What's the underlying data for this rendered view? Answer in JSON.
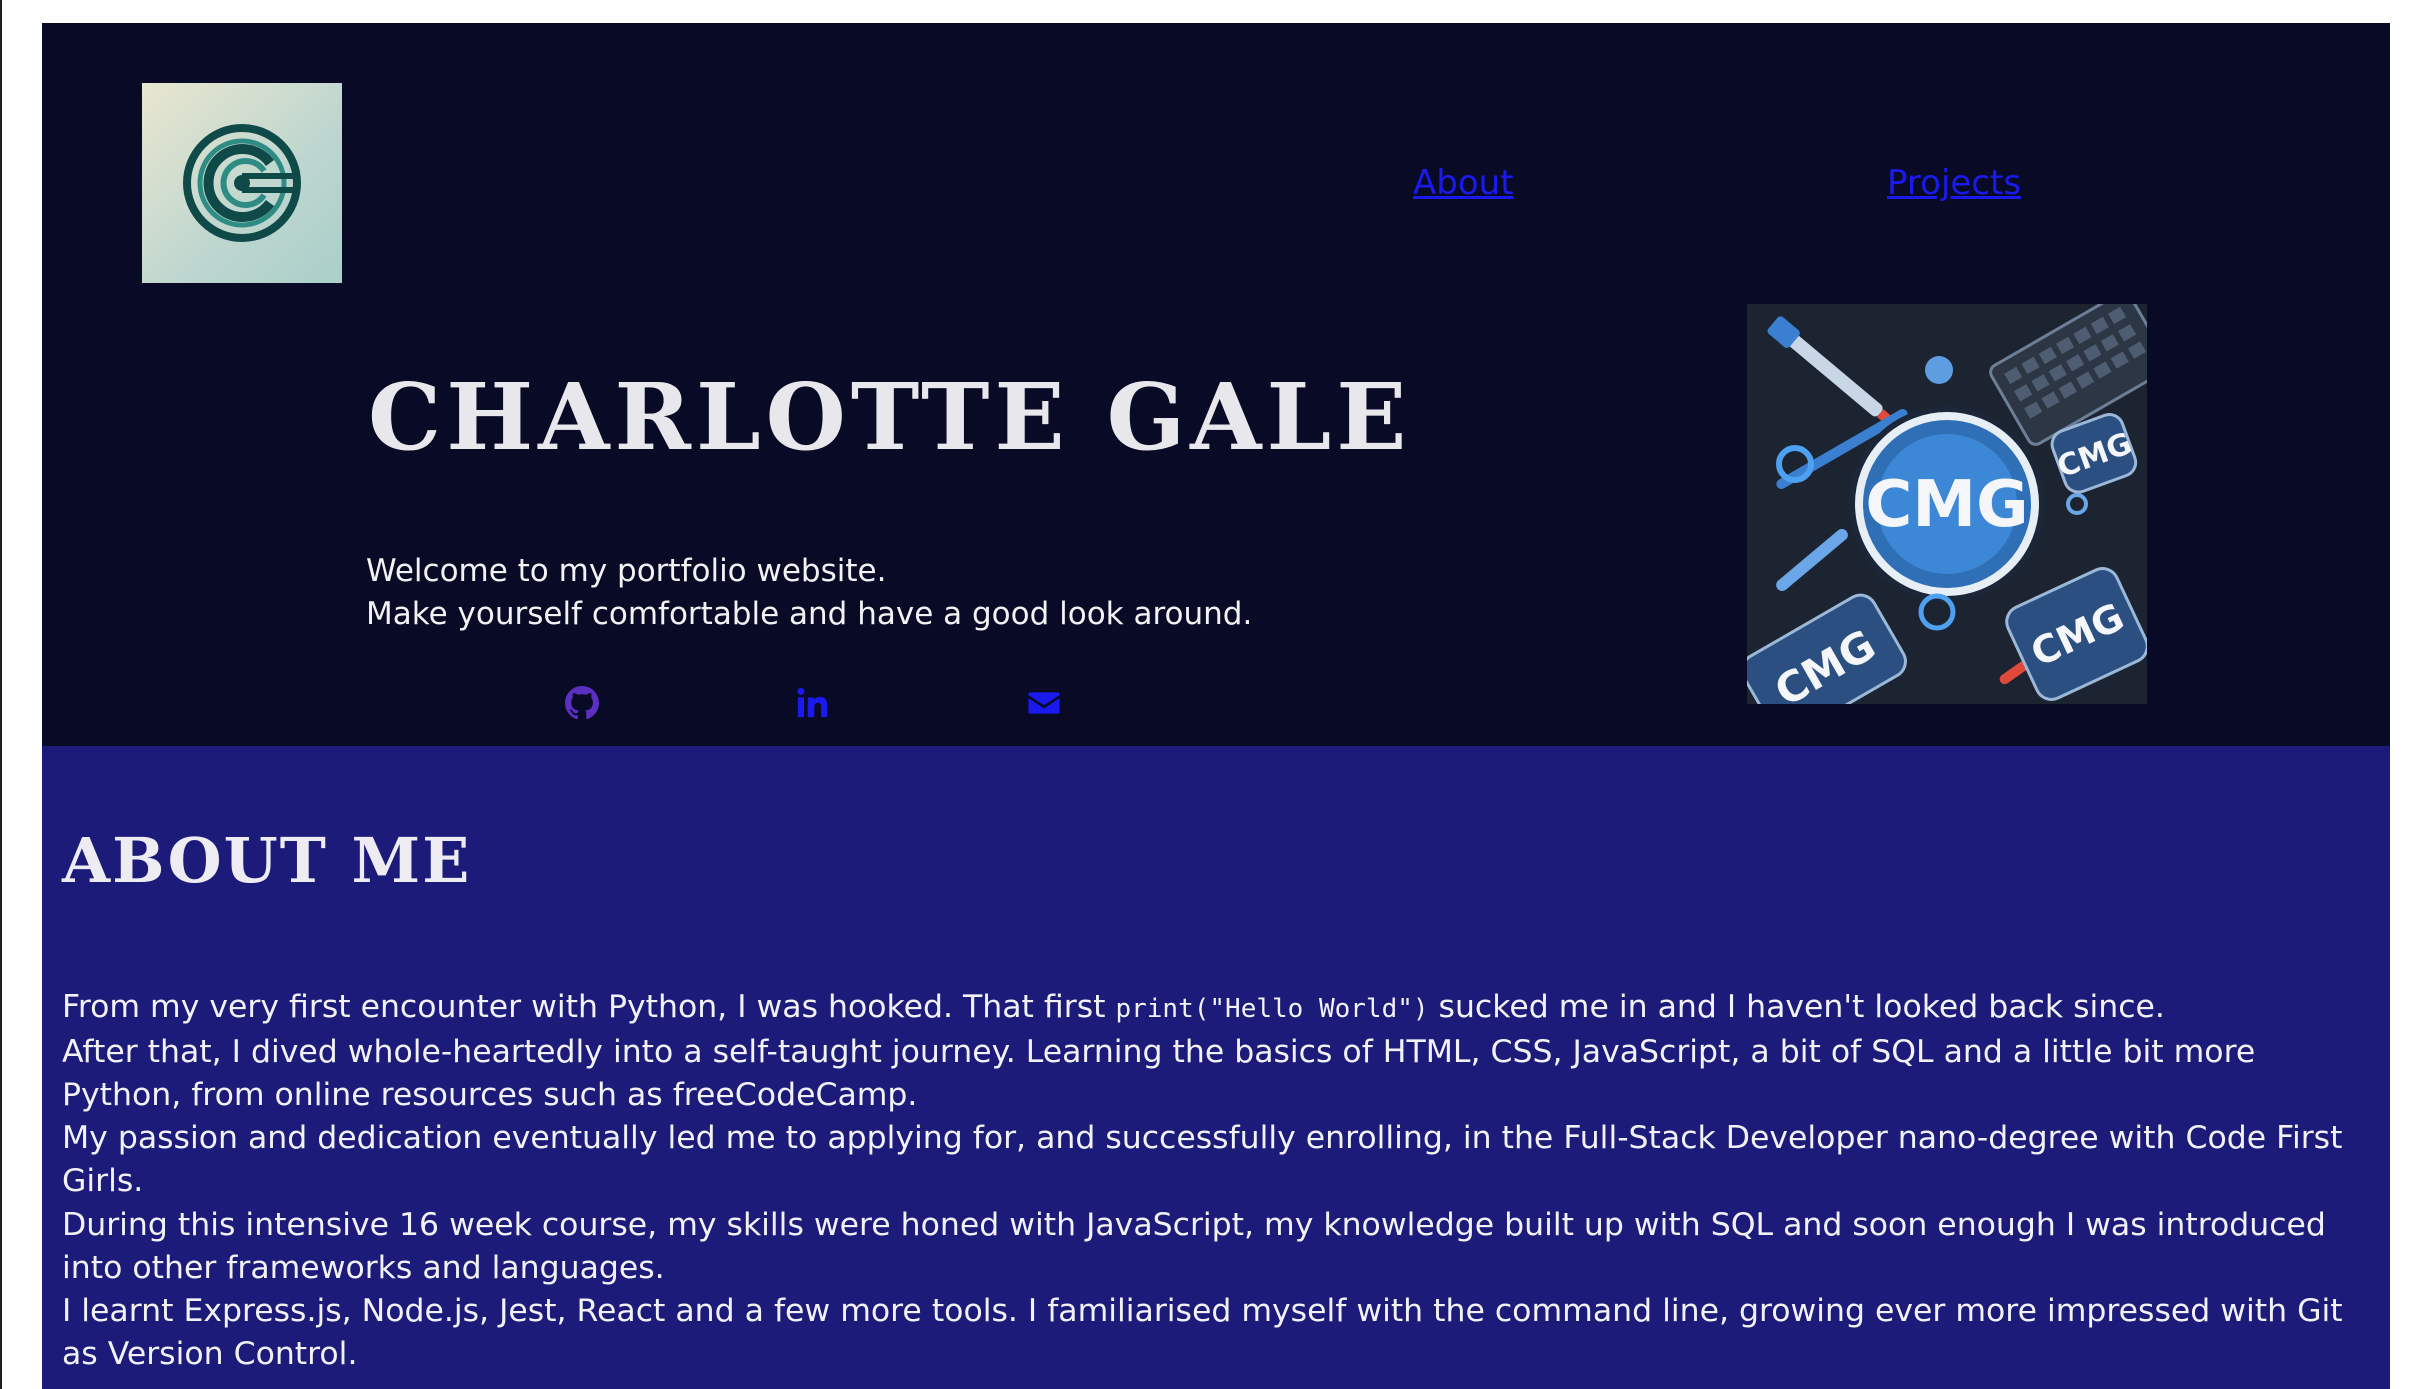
{
  "nav": {
    "about_label": "About",
    "projects_label": "Projects"
  },
  "hero": {
    "name": "CHARLOTTE GALE",
    "tagline_line1": "Welcome to my portfolio website.",
    "tagline_line2": "Make yourself comfortable and have a good look around.",
    "social_icons": [
      "github-icon",
      "linkedin-icon",
      "email-icon"
    ],
    "brand_art_text": "CMG"
  },
  "about": {
    "title": "ABOUT ME",
    "p1_before_code": "From my very first encounter with Python, I was hooked. That first ",
    "p1_code": "print(\"Hello World\")",
    "p1_after_code": " sucked me in and I haven't looked back since.",
    "p1_line2": "After that, I dived whole-heartedly into a self-taught journey. Learning the basics of HTML, CSS, JavaScript, a bit of SQL and a little bit more Python, from online resources such as freeCodeCamp.",
    "p1_line3": "My passion and dedication eventually led me to applying for, and successfully enrolling, in the Full-Stack Developer nano-degree with Code First Girls.",
    "p2_line1": "During this intensive 16 week course, my skills were honed with JavaScript, my knowledge built up with SQL and soon enough I was introduced into other frameworks and languages.",
    "p2_line2": "I learnt Express.js, Node.js, Jest, React and a few more tools. I familiarised myself with the command line, growing ever more impressed with Git as Version Control."
  },
  "colors": {
    "header_bg": "#080a26",
    "about_bg": "#1c1b7a",
    "link": "#1a1aee",
    "github_icon": "#5b2fbf",
    "text": "#f2f2f4"
  }
}
